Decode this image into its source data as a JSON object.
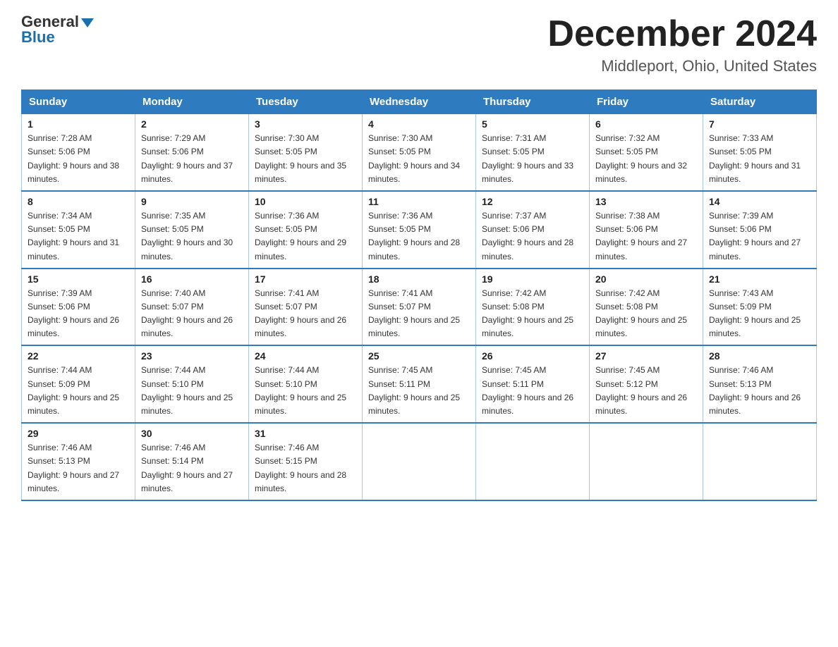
{
  "header": {
    "logo_line1": "General",
    "logo_line2": "Blue",
    "month": "December 2024",
    "location": "Middleport, Ohio, United States"
  },
  "days_of_week": [
    "Sunday",
    "Monday",
    "Tuesday",
    "Wednesday",
    "Thursday",
    "Friday",
    "Saturday"
  ],
  "weeks": [
    [
      {
        "day": "1",
        "sunrise": "7:28 AM",
        "sunset": "5:06 PM",
        "daylight": "9 hours and 38 minutes."
      },
      {
        "day": "2",
        "sunrise": "7:29 AM",
        "sunset": "5:06 PM",
        "daylight": "9 hours and 37 minutes."
      },
      {
        "day": "3",
        "sunrise": "7:30 AM",
        "sunset": "5:05 PM",
        "daylight": "9 hours and 35 minutes."
      },
      {
        "day": "4",
        "sunrise": "7:30 AM",
        "sunset": "5:05 PM",
        "daylight": "9 hours and 34 minutes."
      },
      {
        "day": "5",
        "sunrise": "7:31 AM",
        "sunset": "5:05 PM",
        "daylight": "9 hours and 33 minutes."
      },
      {
        "day": "6",
        "sunrise": "7:32 AM",
        "sunset": "5:05 PM",
        "daylight": "9 hours and 32 minutes."
      },
      {
        "day": "7",
        "sunrise": "7:33 AM",
        "sunset": "5:05 PM",
        "daylight": "9 hours and 31 minutes."
      }
    ],
    [
      {
        "day": "8",
        "sunrise": "7:34 AM",
        "sunset": "5:05 PM",
        "daylight": "9 hours and 31 minutes."
      },
      {
        "day": "9",
        "sunrise": "7:35 AM",
        "sunset": "5:05 PM",
        "daylight": "9 hours and 30 minutes."
      },
      {
        "day": "10",
        "sunrise": "7:36 AM",
        "sunset": "5:05 PM",
        "daylight": "9 hours and 29 minutes."
      },
      {
        "day": "11",
        "sunrise": "7:36 AM",
        "sunset": "5:05 PM",
        "daylight": "9 hours and 28 minutes."
      },
      {
        "day": "12",
        "sunrise": "7:37 AM",
        "sunset": "5:06 PM",
        "daylight": "9 hours and 28 minutes."
      },
      {
        "day": "13",
        "sunrise": "7:38 AM",
        "sunset": "5:06 PM",
        "daylight": "9 hours and 27 minutes."
      },
      {
        "day": "14",
        "sunrise": "7:39 AM",
        "sunset": "5:06 PM",
        "daylight": "9 hours and 27 minutes."
      }
    ],
    [
      {
        "day": "15",
        "sunrise": "7:39 AM",
        "sunset": "5:06 PM",
        "daylight": "9 hours and 26 minutes."
      },
      {
        "day": "16",
        "sunrise": "7:40 AM",
        "sunset": "5:07 PM",
        "daylight": "9 hours and 26 minutes."
      },
      {
        "day": "17",
        "sunrise": "7:41 AM",
        "sunset": "5:07 PM",
        "daylight": "9 hours and 26 minutes."
      },
      {
        "day": "18",
        "sunrise": "7:41 AM",
        "sunset": "5:07 PM",
        "daylight": "9 hours and 25 minutes."
      },
      {
        "day": "19",
        "sunrise": "7:42 AM",
        "sunset": "5:08 PM",
        "daylight": "9 hours and 25 minutes."
      },
      {
        "day": "20",
        "sunrise": "7:42 AM",
        "sunset": "5:08 PM",
        "daylight": "9 hours and 25 minutes."
      },
      {
        "day": "21",
        "sunrise": "7:43 AM",
        "sunset": "5:09 PM",
        "daylight": "9 hours and 25 minutes."
      }
    ],
    [
      {
        "day": "22",
        "sunrise": "7:44 AM",
        "sunset": "5:09 PM",
        "daylight": "9 hours and 25 minutes."
      },
      {
        "day": "23",
        "sunrise": "7:44 AM",
        "sunset": "5:10 PM",
        "daylight": "9 hours and 25 minutes."
      },
      {
        "day": "24",
        "sunrise": "7:44 AM",
        "sunset": "5:10 PM",
        "daylight": "9 hours and 25 minutes."
      },
      {
        "day": "25",
        "sunrise": "7:45 AM",
        "sunset": "5:11 PM",
        "daylight": "9 hours and 25 minutes."
      },
      {
        "day": "26",
        "sunrise": "7:45 AM",
        "sunset": "5:11 PM",
        "daylight": "9 hours and 26 minutes."
      },
      {
        "day": "27",
        "sunrise": "7:45 AM",
        "sunset": "5:12 PM",
        "daylight": "9 hours and 26 minutes."
      },
      {
        "day": "28",
        "sunrise": "7:46 AM",
        "sunset": "5:13 PM",
        "daylight": "9 hours and 26 minutes."
      }
    ],
    [
      {
        "day": "29",
        "sunrise": "7:46 AM",
        "sunset": "5:13 PM",
        "daylight": "9 hours and 27 minutes."
      },
      {
        "day": "30",
        "sunrise": "7:46 AM",
        "sunset": "5:14 PM",
        "daylight": "9 hours and 27 minutes."
      },
      {
        "day": "31",
        "sunrise": "7:46 AM",
        "sunset": "5:15 PM",
        "daylight": "9 hours and 28 minutes."
      },
      {
        "day": "",
        "sunrise": "",
        "sunset": "",
        "daylight": ""
      },
      {
        "day": "",
        "sunrise": "",
        "sunset": "",
        "daylight": ""
      },
      {
        "day": "",
        "sunrise": "",
        "sunset": "",
        "daylight": ""
      },
      {
        "day": "",
        "sunrise": "",
        "sunset": "",
        "daylight": ""
      }
    ]
  ]
}
